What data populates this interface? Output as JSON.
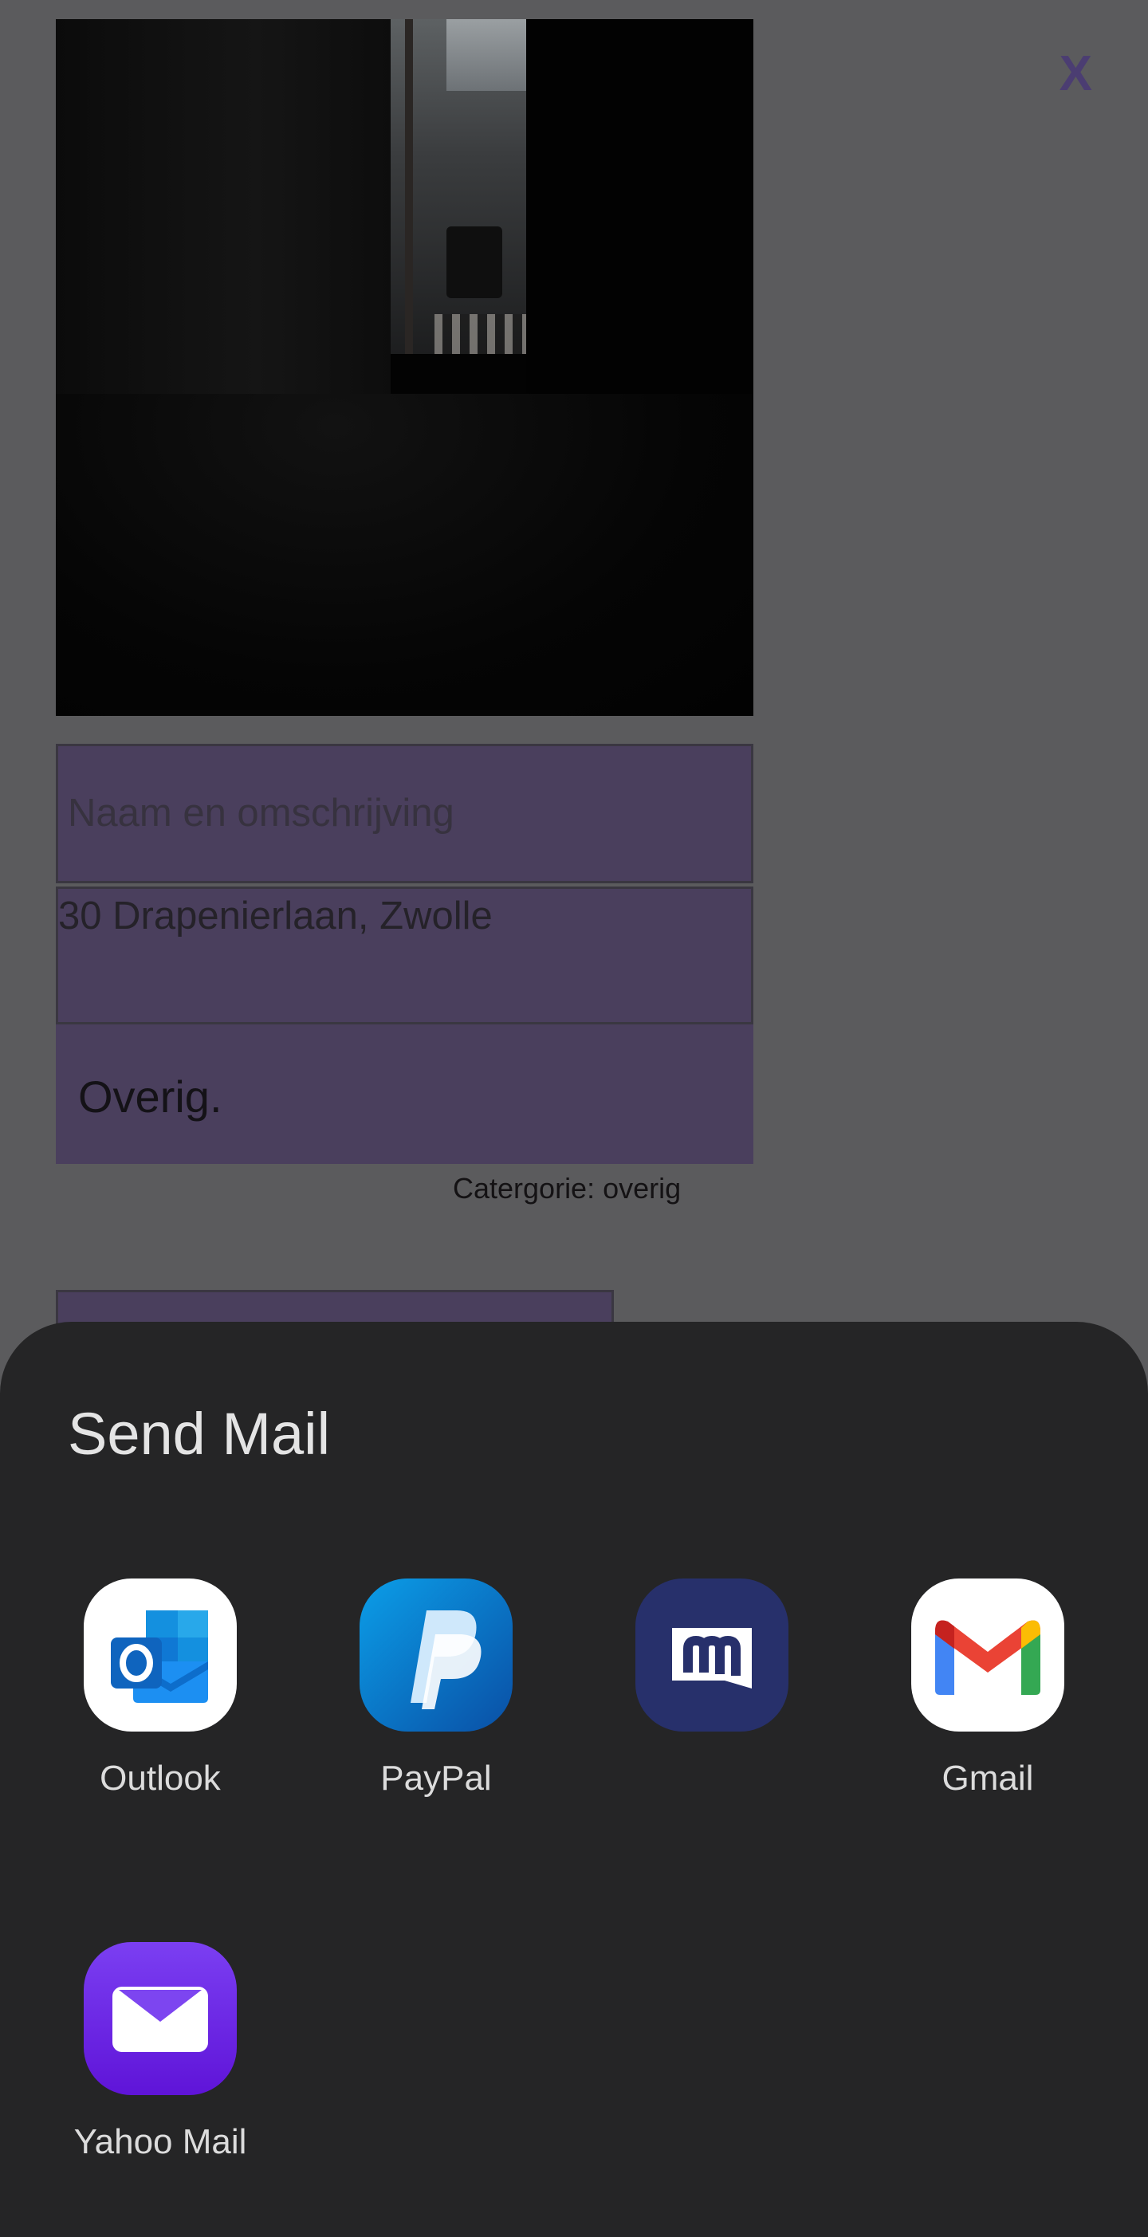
{
  "form": {
    "close_label": "X",
    "name_placeholder": "Naam en omschrijving",
    "address_value": "30 Drapenierlaan, Zwolle",
    "category_value": "Overig.",
    "category_note": "Catergorie: overig"
  },
  "sheet": {
    "title": "Send Mail",
    "apps": [
      {
        "label": "Outlook",
        "icon": "outlook-icon"
      },
      {
        "label": "PayPal",
        "icon": "paypal-icon"
      },
      {
        "label": "",
        "icon": "mailbox-icon"
      },
      {
        "label": "Gmail",
        "icon": "gmail-icon"
      },
      {
        "label": "Yahoo Mail",
        "icon": "yahoo-mail-icon"
      }
    ]
  },
  "colors": {
    "overlay": "#5b5b5d",
    "field": "#4a3f5d",
    "sheet": "#252526",
    "accent": "#4b3d72"
  }
}
